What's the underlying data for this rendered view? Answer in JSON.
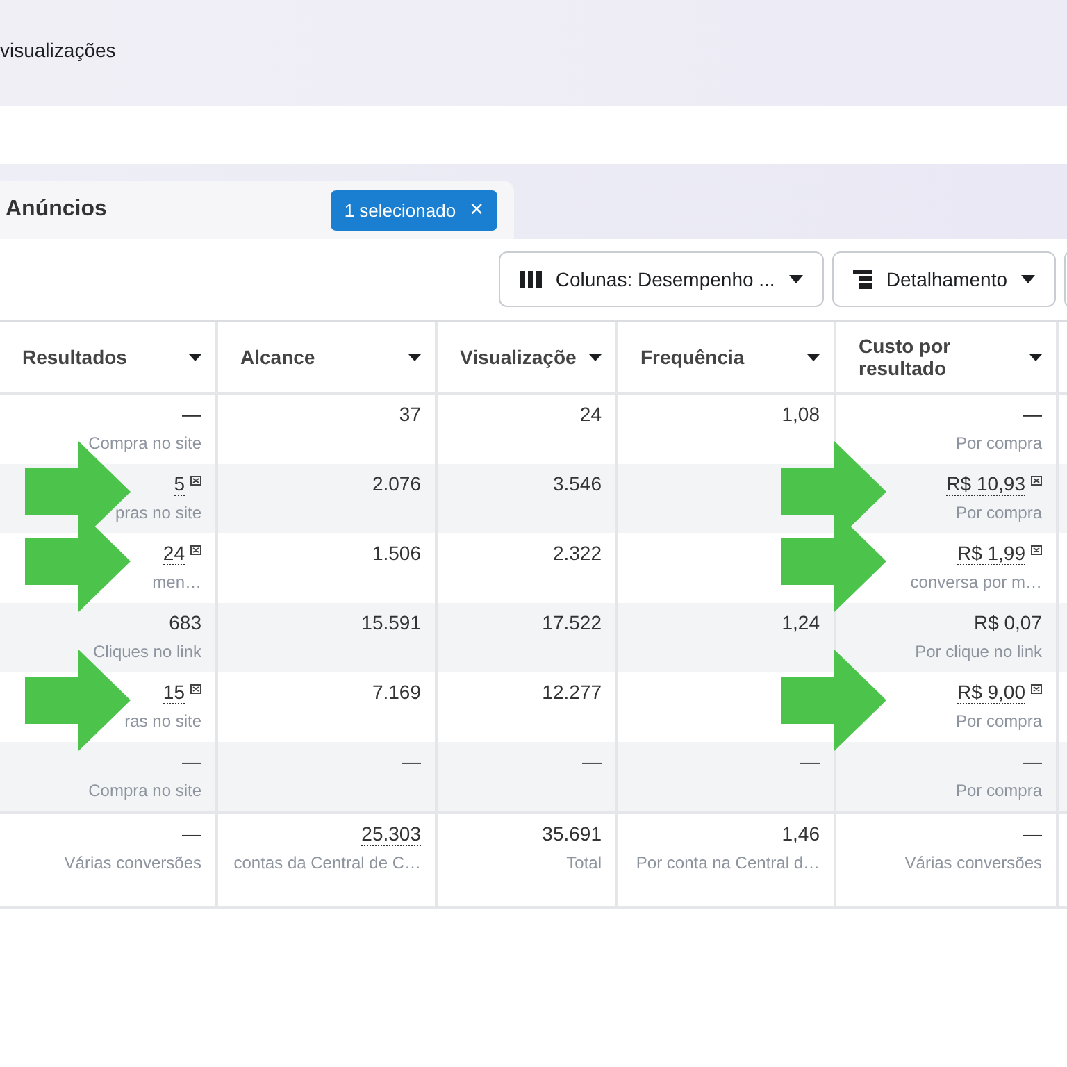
{
  "header": {
    "title": "visualizações"
  },
  "tab": {
    "label": "Anúncios",
    "badge": "1 selecionado",
    "badge_close": "×"
  },
  "toolbar": {
    "buttons": [
      {
        "kind": "columns",
        "label": "Colunas: Desempenho ..."
      },
      {
        "kind": "breakdown",
        "label": "Detalhamento"
      }
    ]
  },
  "table": {
    "columns": [
      "Resultados",
      "Alcance",
      "Visualizaçõe",
      "Frequência",
      "Custo por resultado"
    ],
    "rows": [
      {
        "cells": [
          {
            "value": "—",
            "sub": "Compra no site"
          },
          {
            "value": "37"
          },
          {
            "value": "24"
          },
          {
            "value": "1,08"
          },
          {
            "value": "—",
            "sub": "Por compra"
          }
        ]
      },
      {
        "highlighted": true,
        "cells": [
          {
            "value": "5",
            "sub": "pras no site",
            "flag": true
          },
          {
            "value": "2.076"
          },
          {
            "value": "3.546"
          },
          {},
          {
            "value": "R$ 10,93",
            "sub": "Por compra",
            "flag": true
          }
        ]
      },
      {
        "highlighted": true,
        "cells": [
          {
            "value": "24",
            "sub": "men…",
            "flag": true
          },
          {
            "value": "1.506"
          },
          {
            "value": "2.322"
          },
          {},
          {
            "value": "R$ 1,99",
            "sub": "conversa por m…",
            "flag": true
          }
        ]
      },
      {
        "cells": [
          {
            "value": "683",
            "sub": "Cliques no link"
          },
          {
            "value": "15.591"
          },
          {
            "value": "17.522"
          },
          {
            "value": "1,24"
          },
          {
            "value": "R$ 0,07",
            "sub": "Por clique no link"
          }
        ]
      },
      {
        "highlighted": true,
        "cells": [
          {
            "value": "15",
            "sub": "ras no site",
            "flag": true
          },
          {
            "value": "7.169"
          },
          {
            "value": "12.277"
          },
          {},
          {
            "value": "R$ 9,00",
            "sub": "Por compra",
            "flag": true
          }
        ]
      },
      {
        "cells": [
          {
            "value": "—",
            "sub": "Compra no site"
          },
          {
            "value": "—"
          },
          {
            "value": "—"
          },
          {
            "value": "—"
          },
          {
            "value": "—",
            "sub": "Por compra"
          }
        ]
      }
    ],
    "total": [
      {
        "value": "—",
        "sub": "Várias conversões"
      },
      {
        "value": "25.303",
        "sub": "contas da Central de C…",
        "underlined": true
      },
      {
        "value": "35.691",
        "sub": "Total"
      },
      {
        "value": "1,46",
        "sub": "Por conta na Central d…"
      },
      {
        "value": "—",
        "sub": "Várias conversões"
      }
    ]
  }
}
